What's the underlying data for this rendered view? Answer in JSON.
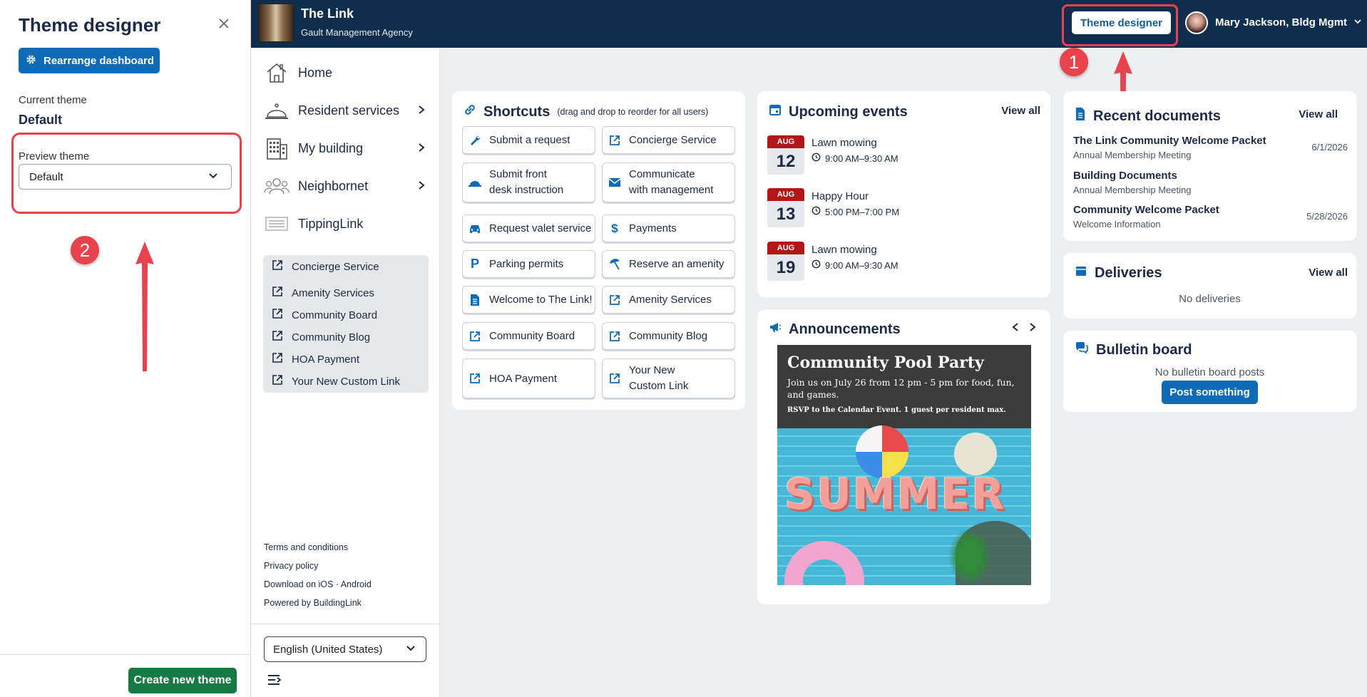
{
  "theme_panel": {
    "title": "Theme designer",
    "rearrange_label": "Rearrange dashboard",
    "current_theme_label": "Current theme",
    "current_theme_value": "Default",
    "preview_label": "Preview theme",
    "preview_value": "Default",
    "create_label": "Create new theme"
  },
  "annotations": {
    "badge1": "1",
    "badge2": "2"
  },
  "topbar": {
    "title": "The Link",
    "subtitle": "Gault Management Agency",
    "theme_button": "Theme designer",
    "user": "Mary Jackson, Bldg Mgmt"
  },
  "nav": {
    "items": [
      {
        "label": "Home",
        "icon": "house-icon"
      },
      {
        "label": "Resident services",
        "icon": "bell-icon"
      },
      {
        "label": "My building",
        "icon": "building-icon"
      },
      {
        "label": "Neighbornet",
        "icon": "people-icon"
      },
      {
        "label": "TippingLink",
        "icon": "list-icon"
      }
    ],
    "links": [
      "Concierge Service",
      "Amenity Services",
      "Community Board",
      "Community Blog",
      "HOA Payment",
      "Your New Custom Link"
    ],
    "footer": [
      "Terms and conditions",
      "Privacy policy",
      "Download on iOS · Android",
      "Powered by BuildingLink"
    ],
    "language": "English (United States)"
  },
  "shortcuts": {
    "title": "Shortcuts",
    "hint": "(drag and drop to reorder for all users)",
    "items": [
      {
        "label": "Submit a request",
        "icon": "wrench-icon"
      },
      {
        "label": "Concierge Service",
        "icon": "external-link-icon"
      },
      {
        "label": "Submit front",
        "label2": "desk instruction",
        "icon": "service-bell-icon"
      },
      {
        "label": "Communicate",
        "label2": "with management",
        "icon": "envelope-icon"
      },
      {
        "label": "Request valet service",
        "icon": "car-icon"
      },
      {
        "label": "Payments",
        "icon": "dollar-icon"
      },
      {
        "label": "Parking permits",
        "icon": "parking-icon"
      },
      {
        "label": "Reserve an amenity",
        "icon": "umbrella-icon"
      },
      {
        "label": "Welcome to The Link!",
        "icon": "document-icon"
      },
      {
        "label": "Amenity Services",
        "icon": "external-link-icon"
      },
      {
        "label": "Community Board",
        "icon": "external-link-icon"
      },
      {
        "label": "Community Blog",
        "icon": "external-link-icon"
      },
      {
        "label": "HOA Payment",
        "icon": "external-link-icon"
      },
      {
        "label": "Your New",
        "label2": "Custom Link",
        "icon": "external-link-icon"
      }
    ]
  },
  "events": {
    "title": "Upcoming events",
    "view_all": "View all",
    "items": [
      {
        "month": "AUG",
        "day": "12",
        "title": "Lawn mowing",
        "time": "9:00 AM–9:30 AM"
      },
      {
        "month": "AUG",
        "day": "13",
        "title": "Happy Hour",
        "time": "5:00 PM–7:00 PM"
      },
      {
        "month": "AUG",
        "day": "19",
        "title": "Lawn mowing",
        "time": "9:00 AM–9:30 AM"
      }
    ]
  },
  "announcements": {
    "title": "Announcements",
    "headline": "Community Pool Party",
    "body": "Join us on July 26 from 12 pm - 5 pm for food, fun, and games.",
    "note": "RSVP to the Calendar Event. 1 guest per resident max.",
    "image_text": "SUMMER"
  },
  "documents": {
    "title": "Recent documents",
    "view_all": "View all",
    "items": [
      {
        "title": "The Link Community Welcome Packet",
        "sub": "Annual Membership Meeting",
        "date": "6/1/2026"
      },
      {
        "title": "Building Documents",
        "sub": "Annual Membership Meeting",
        "date": ""
      },
      {
        "title": "Community Welcome Packet",
        "sub": "Welcome Information",
        "date": "5/28/2026"
      }
    ]
  },
  "deliveries": {
    "title": "Deliveries",
    "view_all": "View all",
    "empty": "No deliveries"
  },
  "bulletin": {
    "title": "Bulletin board",
    "empty": "No bulletin board posts",
    "post_label": "Post something"
  },
  "colors": {
    "navy": "#0f2e4e",
    "primary": "#0d6bb8",
    "green": "#177a45",
    "annotation_red": "#e8424c",
    "date_red": "#b21616"
  }
}
